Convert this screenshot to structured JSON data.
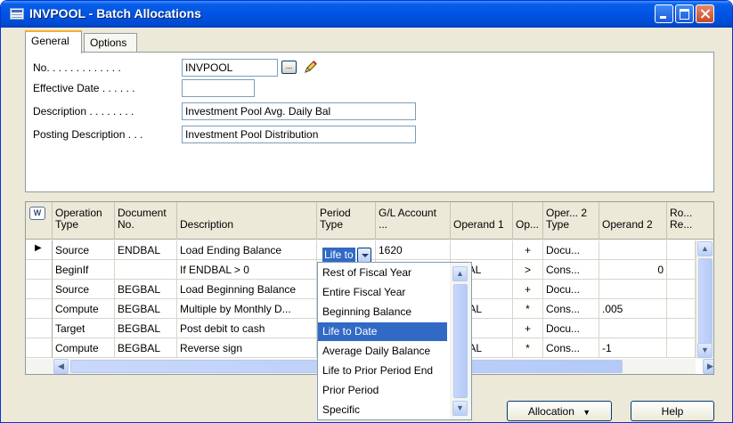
{
  "window": {
    "title": "INVPOOL - Batch Allocations"
  },
  "tabs": [
    "General",
    "Options"
  ],
  "general": {
    "no_label": "No. . . . . . . . . . . . .",
    "no_value": "INVPOOL",
    "effective_date_label": "Effective Date . . . . . .",
    "effective_date_value": "",
    "description_label": "Description . . . . . . . .",
    "description_value": "Investment Pool Avg. Daily Bal",
    "posting_description_label": "Posting Description . . .",
    "posting_description_value": "Investment Pool Distribution"
  },
  "grid": {
    "headers": {
      "operation_type": "Operation Type",
      "document_no": "Document No.",
      "description": "Description",
      "period_type": "Period Type",
      "gl_account": "G/L Account ...",
      "operand1": "Operand 1",
      "op": "Op...",
      "oper2_type": "Oper... 2 Type",
      "operand2": "Operand 2",
      "ro_re": "Ro... Re..."
    },
    "rows": [
      {
        "operation_type": "Source",
        "document_no": "ENDBAL",
        "description": "Load Ending Balance",
        "period_type": "Life to",
        "gl_account": "1620",
        "operand1": "",
        "op": "+",
        "oper2_type": "Docu...",
        "operand2": ""
      },
      {
        "operation_type": "BeginIf",
        "document_no": "",
        "description": "If ENDBAL > 0",
        "period_type": "",
        "gl_account": "",
        "operand1": "DBAL",
        "op": ">",
        "oper2_type": "Cons...",
        "operand2": "0"
      },
      {
        "operation_type": "Source",
        "document_no": "BEGBAL",
        "description": "Load Beginning Balance",
        "period_type": "",
        "gl_account": "",
        "operand1": "",
        "op": "+",
        "oper2_type": "Docu...",
        "operand2": ""
      },
      {
        "operation_type": "Compute",
        "document_no": "BEGBAL",
        "description": "Multiple by Monthly D...",
        "period_type": "",
        "gl_account": "",
        "operand1": "GBAL",
        "op": "*",
        "oper2_type": "Cons...",
        "operand2": ".005"
      },
      {
        "operation_type": "Target",
        "document_no": "BEGBAL",
        "description": "Post debit to cash",
        "period_type": "",
        "gl_account": "",
        "operand1": "",
        "op": "+",
        "oper2_type": "Docu...",
        "operand2": ""
      },
      {
        "operation_type": "Compute",
        "document_no": "BEGBAL",
        "description": "Reverse sign",
        "period_type": "",
        "gl_account": "",
        "operand1": "GBAL",
        "op": "*",
        "oper2_type": "Cons...",
        "operand2": "-1"
      }
    ]
  },
  "period_type_dropdown": {
    "options": [
      "Rest of Fiscal Year",
      "Entire Fiscal Year",
      "Beginning Balance",
      "Life to Date",
      "Average Daily Balance",
      "Life to Prior Period End",
      "Prior Period",
      "Specific"
    ],
    "selected": "Life to Date"
  },
  "buttons": {
    "allocation": "Allocation",
    "help": "Help"
  },
  "icons": {
    "grid_corner": "W"
  },
  "colors": {
    "titlebar": "#0054e3",
    "selection": "#316ac5",
    "window_bg": "#ece9d8"
  }
}
